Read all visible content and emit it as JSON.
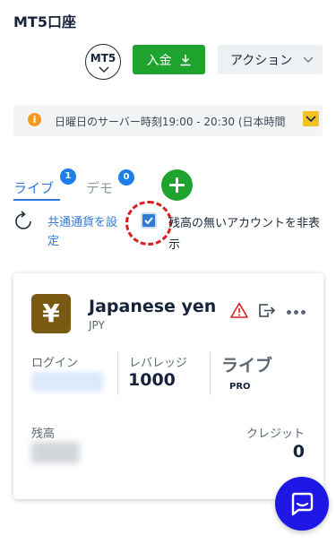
{
  "page": {
    "title": "MT5口座"
  },
  "header": {
    "platform_badge": "MT5",
    "deposit_label": "入金",
    "action_label": "アクション"
  },
  "notice": {
    "text": "日曜日のサーバー時刻19:00 - 20:30 (日本時間"
  },
  "tabs": [
    {
      "label": "ライブ",
      "count": "1",
      "active": true
    },
    {
      "label": "デモ",
      "count": "0",
      "active": false
    }
  ],
  "options": {
    "shared_currency_label": "共通通貨を設定",
    "hide_empty_label": "残高の無いアカウントを非表示",
    "hide_empty_checked": true
  },
  "account": {
    "name": "Japanese yen",
    "code": "JPY",
    "currency_symbol": "¥",
    "login_label": "ログイン",
    "leverage_label": "レバレッジ",
    "leverage_value": "1000",
    "type": "ライブ",
    "type_sub": "PRO",
    "balance_label": "残高",
    "credit_label": "クレジット",
    "credit_value": "0"
  },
  "colors": {
    "primary_green": "#1fa32f",
    "link_blue": "#2f7ad9",
    "badge_blue": "#1e7ee8",
    "chat_blue": "#1f17e6",
    "warning_red": "#d81f1f",
    "notice_yellow": "#f2c126"
  },
  "icons": {
    "deposit": "download-icon",
    "notice": "info-icon",
    "refresh": "refresh-icon",
    "warning": "warning-icon",
    "export": "export-icon",
    "more": "more-icon",
    "chat": "chat-icon"
  }
}
